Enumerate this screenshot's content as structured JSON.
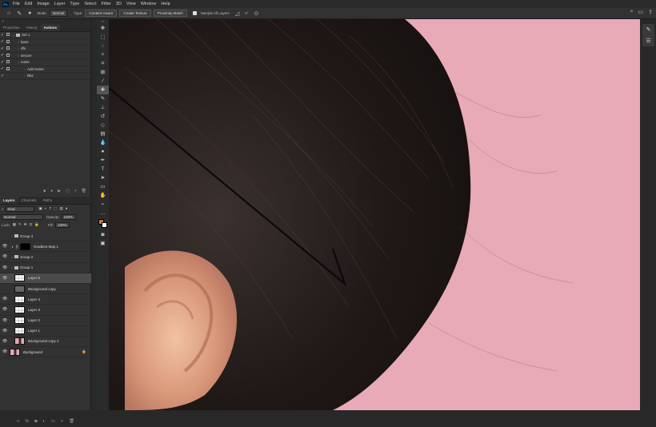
{
  "app": {
    "logo": "Ps"
  },
  "menu": [
    "File",
    "Edit",
    "Image",
    "Layer",
    "Type",
    "Select",
    "Filter",
    "3D",
    "View",
    "Window",
    "Help"
  ],
  "options": {
    "mode_label": "Mode:",
    "mode_value": "Normal",
    "type_label": "Type:",
    "buttons": [
      "Content-Aware",
      "Create Texture",
      "Proximity Match"
    ],
    "sample_all_layers": "Sample All Layers",
    "angle": "0°"
  },
  "left_top": {
    "tabs": [
      "Properties",
      "History",
      "Actions"
    ],
    "actions": [
      {
        "label": "Set 1",
        "folder": true,
        "expanded": true
      },
      {
        "label": "base",
        "folder": false,
        "expanded": false
      },
      {
        "label": "dfs",
        "folder": false,
        "expanded": false
      },
      {
        "label": "secure",
        "folder": false,
        "expanded": false
      },
      {
        "label": "noise",
        "folder": false,
        "expanded": true
      },
      {
        "label": "Add Noise",
        "folder": false,
        "expanded": false
      },
      {
        "label": "Blur",
        "folder": false,
        "expanded": false
      }
    ]
  },
  "layers_panel": {
    "tabs": [
      "Layers",
      "Channels",
      "Paths"
    ],
    "filter": "Kind",
    "blend": "Normal",
    "opacity_label": "Opacity:",
    "opacity": "100%",
    "lock_label": "Lock:",
    "fill_label": "Fill:",
    "fill": "100%",
    "layers": [
      {
        "name": "Group 3",
        "type": "group",
        "visible": false,
        "indent": 0,
        "thumb": "none"
      },
      {
        "name": "Gradient Map 1",
        "type": "adjust",
        "visible": true,
        "indent": 0,
        "thumb": "black"
      },
      {
        "name": "Group 2",
        "type": "group",
        "visible": true,
        "indent": 0,
        "thumb": "none"
      },
      {
        "name": "Group 1",
        "type": "group",
        "visible": true,
        "indent": 0,
        "thumb": "none"
      },
      {
        "name": "Layer 5",
        "type": "layer",
        "visible": true,
        "indent": 1,
        "thumb": "trans",
        "selected": true
      },
      {
        "name": "Background copy",
        "type": "layer",
        "visible": false,
        "indent": 1,
        "thumb": "gray"
      },
      {
        "name": "Layer 4",
        "type": "layer",
        "visible": true,
        "indent": 1,
        "thumb": "trans"
      },
      {
        "name": "Layer 3",
        "type": "layer",
        "visible": true,
        "indent": 1,
        "thumb": "trans"
      },
      {
        "name": "Layer 2",
        "type": "layer",
        "visible": true,
        "indent": 1,
        "thumb": "trans"
      },
      {
        "name": "Layer 1",
        "type": "layer",
        "visible": true,
        "indent": 1,
        "thumb": "trans"
      },
      {
        "name": "Background copy 2",
        "type": "layer",
        "visible": true,
        "indent": 1,
        "thumb": "photo"
      },
      {
        "name": "Background",
        "type": "layer",
        "visible": true,
        "indent": 0,
        "thumb": "photo",
        "locked": true
      }
    ]
  },
  "colors": {
    "foreground": "#c0794e",
    "background": "#ffffff",
    "canvas_bg": "#e8aab6"
  }
}
